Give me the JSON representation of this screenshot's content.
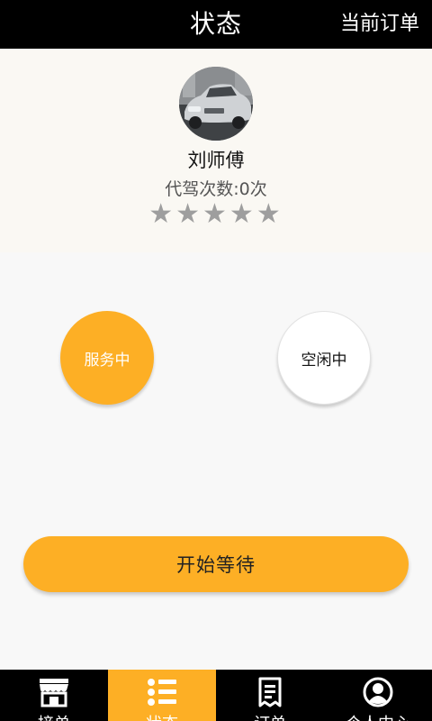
{
  "header": {
    "title": "状态",
    "action_label": "当前订单"
  },
  "profile": {
    "name": "刘师傅",
    "trips_text": "代驾次数:0次",
    "rating_stars": 5,
    "stars_text": "★★★★★",
    "star_color": "#9e9e9e"
  },
  "status": {
    "serving_label": "服务中",
    "idle_label": "空闲中"
  },
  "start_button_label": "开始等待",
  "tabs": [
    {
      "label": "接单",
      "icon": "store-icon",
      "active": false
    },
    {
      "label": "状态",
      "icon": "list-icon",
      "active": true
    },
    {
      "label": "订单",
      "icon": "document-icon",
      "active": false
    },
    {
      "label": "个人中心",
      "icon": "user-circle-icon",
      "active": false
    }
  ],
  "colors": {
    "accent": "#fdaf25",
    "bar": "#000000",
    "profile_bg": "#faf8f3"
  }
}
